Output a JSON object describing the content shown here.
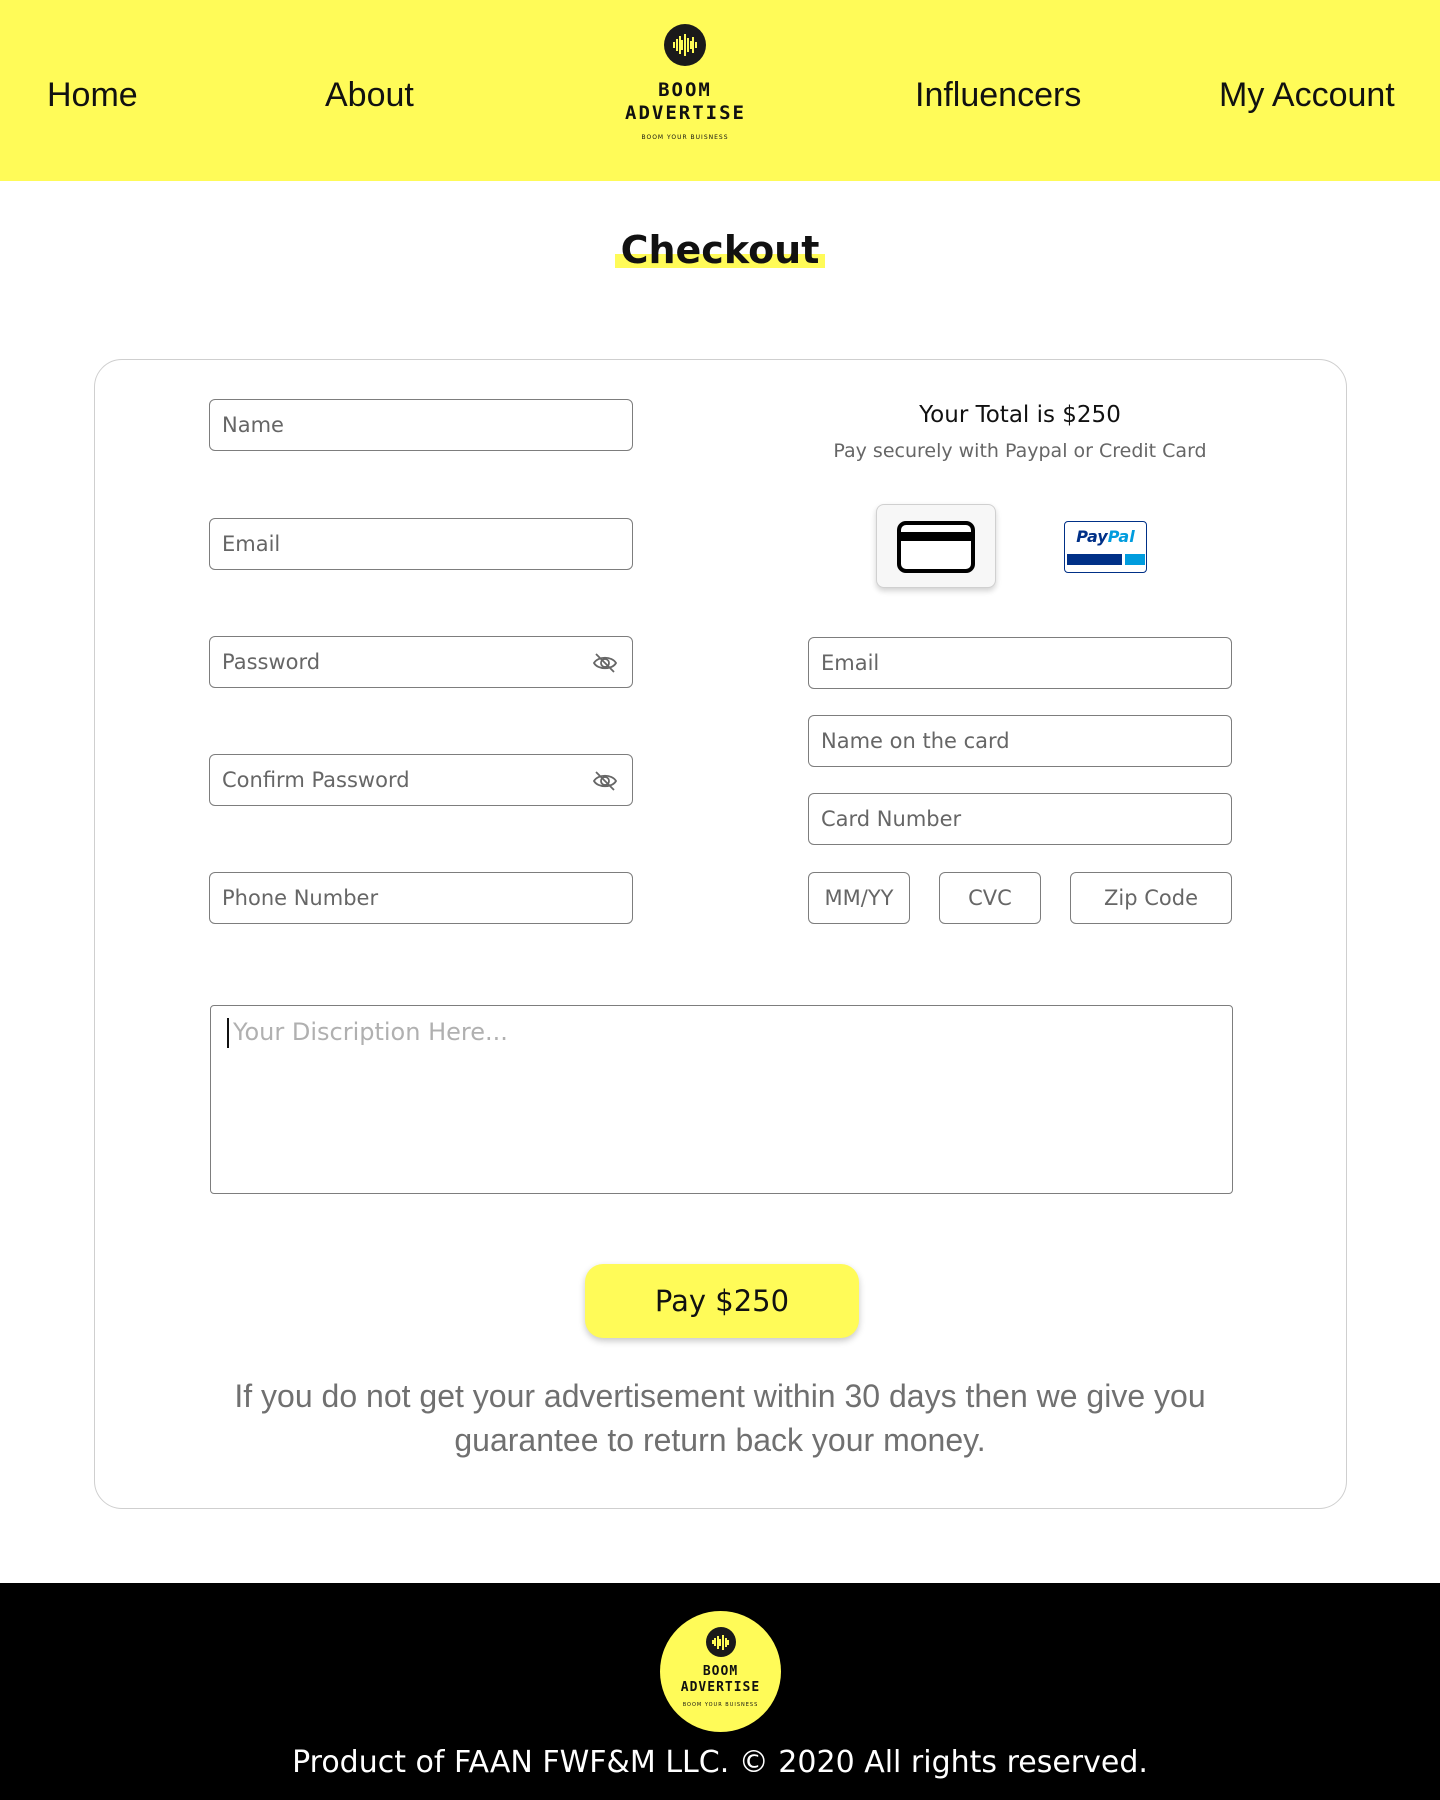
{
  "header": {
    "nav": {
      "home": "Home",
      "about": "About",
      "influencers": "Influencers",
      "account": "My Account"
    },
    "logo": {
      "title_line1": "BOOM",
      "title_line2": "ADVERTISE",
      "tagline": "BOOM YOUR BUISNESS"
    }
  },
  "page_title": "Checkout",
  "account_form": {
    "name_placeholder": "Name",
    "email_placeholder": "Email",
    "password_placeholder": "Password",
    "confirm_password_placeholder": "Confirm Password",
    "phone_placeholder": "Phone Number"
  },
  "payment": {
    "total_text": "Your Total is $250",
    "subtitle": "Pay securely with Paypal or Credit Card",
    "methods": {
      "card_icon": "credit-card-icon",
      "paypal_label_1": "Pay",
      "paypal_label_2": "Pal"
    },
    "email_placeholder": "Email",
    "name_on_card_placeholder": "Name on the card",
    "card_number_placeholder": "Card Number",
    "expiry_placeholder": "MM/YY",
    "cvc_placeholder": "CVC",
    "zip_placeholder": "Zip Code"
  },
  "description_placeholder": "Your Discription Here...",
  "pay_button": "Pay $250",
  "guarantee_line1": "If you do not get your advertisement within 30 days then we give you",
  "guarantee_line2": "guarantee to return back your money.",
  "footer": {
    "copyright": "Product of FAAN FWF&M LLC.  © 2020 All rights reserved."
  },
  "colors": {
    "accent": "#fffb58",
    "footer_bg": "#000000",
    "paypal_dark": "#003087",
    "paypal_light": "#009cde"
  }
}
